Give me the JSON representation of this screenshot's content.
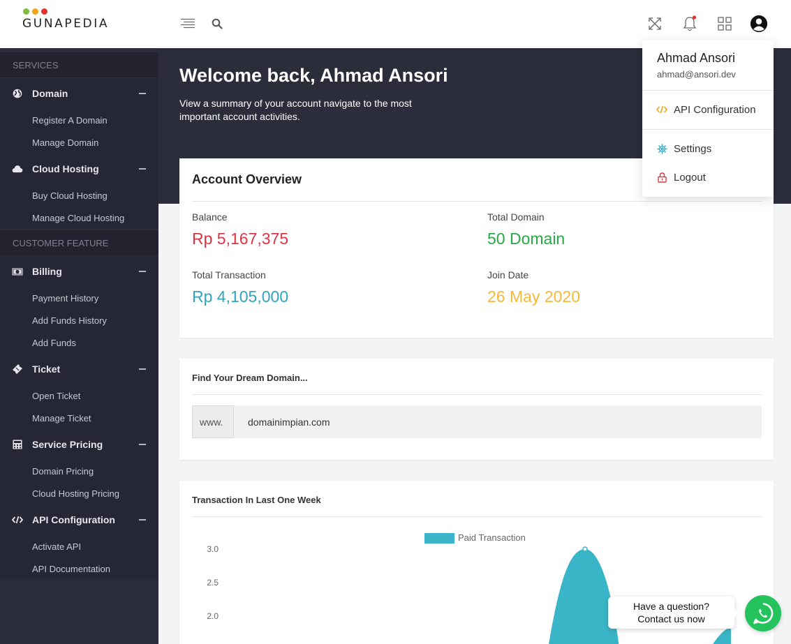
{
  "brand": {
    "name": "GUNAPEDIA",
    "dot_colors": [
      "#7dba3f",
      "#f2a516",
      "#e0322e"
    ]
  },
  "header": {
    "icons": [
      "menu-icon",
      "search-icon",
      "fullscreen-icon",
      "notification-bell-icon",
      "apps-grid-icon",
      "user-account-icon"
    ]
  },
  "sidebar": {
    "sections": [
      {
        "title": "SERVICES",
        "groups": [
          {
            "label": "Domain",
            "icon": "globe-icon",
            "items": [
              "Register A Domain",
              "Manage Domain"
            ]
          },
          {
            "label": "Cloud Hosting",
            "icon": "cloud-icon",
            "items": [
              "Buy Cloud Hosting",
              "Manage Cloud Hosting"
            ]
          }
        ]
      },
      {
        "title": "CUSTOMER FEATURE",
        "groups": [
          {
            "label": "Billing",
            "icon": "money-icon",
            "items": [
              "Payment History",
              "Add Funds History",
              "Add Funds"
            ]
          },
          {
            "label": "Ticket",
            "icon": "ticket-icon",
            "items": [
              "Open Ticket",
              "Manage Ticket"
            ]
          },
          {
            "label": "Service Pricing",
            "icon": "calculator-icon",
            "items": [
              "Domain Pricing",
              "Cloud Hosting Pricing"
            ]
          },
          {
            "label": "API Configuration",
            "icon": "code-icon",
            "items": [
              "Activate API",
              "API Documentation"
            ]
          }
        ]
      }
    ]
  },
  "hero": {
    "title": "Welcome back, Ahmad Ansori",
    "subtitle": "View a summary of your account navigate to the most important account activities."
  },
  "overview": {
    "title": "Account Overview",
    "balance": {
      "label": "Balance",
      "value": "Rp 5,167,375",
      "color": "#dc3545"
    },
    "total_domain": {
      "label": "Total Domain",
      "value": "50 Domain",
      "color": "#28a745"
    },
    "total_transaction": {
      "label": "Total Transaction",
      "value": "Rp 4,105,000",
      "color": "#2ea6bd"
    },
    "join_date": {
      "label": "Join Date",
      "value": "26 May 2020",
      "color": "#f4b936"
    }
  },
  "domain_search": {
    "title": "Find Your Dream Domain...",
    "prefix": "www.",
    "value": "domainimpian.com"
  },
  "transactions": {
    "title": "Transaction In Last One Week"
  },
  "chart_data": {
    "type": "area",
    "title": "",
    "xlabel": "",
    "ylabel": "",
    "y_ticks": [
      "3.0",
      "2.5",
      "2.0"
    ],
    "ylim_visible": [
      2.0,
      3.0
    ],
    "series": [
      {
        "name": "Paid Transaction",
        "color": "#3ab5c8",
        "peak_value": 3.0
      }
    ],
    "legend_position": "top-center"
  },
  "user_menu": {
    "name": "Ahmad Ansori",
    "email": "ahmad@ansori.dev",
    "items": [
      {
        "label": "API Configuration",
        "icon": "code-icon",
        "color": "#f2a516"
      },
      {
        "label": "Settings",
        "icon": "gear-icon",
        "color": "#2ea6bd"
      },
      {
        "label": "Logout",
        "icon": "lock-icon",
        "color": "#dc3545"
      }
    ]
  },
  "help": {
    "line1": "Have a question?",
    "line2": "Contact us now"
  }
}
